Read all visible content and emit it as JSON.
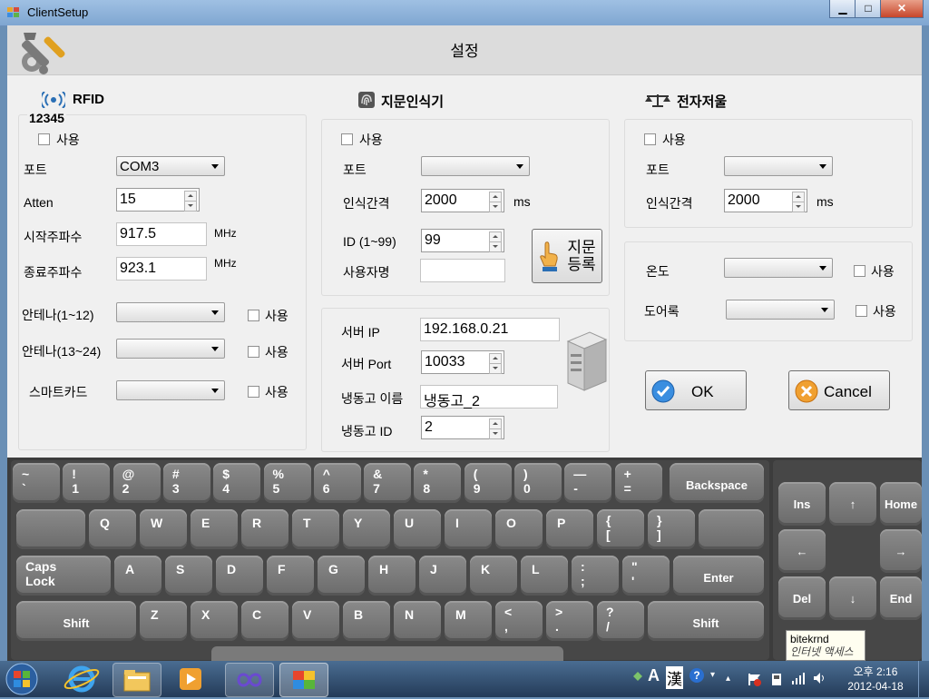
{
  "window": {
    "title": "ClientSetup",
    "min": "▁",
    "max": "□",
    "close": "✕"
  },
  "header": {
    "title": "설정"
  },
  "rfid": {
    "title": "RFID",
    "code": "12345",
    "use_label": "사용",
    "port_label": "포트",
    "port_value": "COM3",
    "atten_label": "Atten",
    "atten_value": "15",
    "start_freq_label": "시작주파수",
    "start_freq_value": "917.5",
    "end_freq_label": "종료주파수",
    "end_freq_value": "923.1",
    "mhz": "MHz",
    "antenna1_label": "안테나(1~12)",
    "antenna2_label": "안테나(13~24)",
    "smartcard_label": "스마트카드",
    "antenna1_use": "사용",
    "antenna2_use": "사용",
    "smartcard_use": "사용"
  },
  "finger": {
    "title": "지문인식기",
    "use_label": "사용",
    "port_label": "포트",
    "interval_label": "인식간격",
    "interval_value": "2000",
    "ms": "ms",
    "id_label": "ID (1~99)",
    "id_value": "99",
    "user_label": "사용자명",
    "user_value": "",
    "register_line1": "지문",
    "register_line2": "등록"
  },
  "server": {
    "ip_label": "서버 IP",
    "ip_value": "192.168.0.21",
    "port_label": "서버 Port",
    "port_value": "10033",
    "fridge_name_label": "냉동고 이름",
    "fridge_name_value": "냉동고_2",
    "fridge_id_label": "냉동고 ID",
    "fridge_id_value": "2"
  },
  "scale": {
    "title": "전자저울",
    "use_label": "사용",
    "port_label": "포트",
    "interval_label": "인식간격",
    "interval_value": "2000",
    "ms": "ms"
  },
  "sensors": {
    "temp_label": "온도",
    "temp_use": "사용",
    "door_label": "도어록",
    "door_use": "사용"
  },
  "buttons": {
    "ok": "OK",
    "cancel": "Cancel"
  },
  "keyboard": {
    "row1": [
      [
        "~",
        "`"
      ],
      [
        "!",
        "1"
      ],
      [
        "@",
        "2"
      ],
      [
        "#",
        "3"
      ],
      [
        "$",
        "4"
      ],
      [
        "%",
        "5"
      ],
      [
        "^",
        "6"
      ],
      [
        "&",
        "7"
      ],
      [
        "*",
        "8"
      ],
      [
        "(",
        "9"
      ],
      [
        ")",
        "0"
      ],
      [
        "—",
        "-"
      ],
      [
        "+",
        "="
      ]
    ],
    "backspace": "Backspace",
    "row2": [
      "Q",
      "W",
      "E",
      "R",
      "T",
      "Y",
      "U",
      "I",
      "O",
      "P"
    ],
    "row2_brackets": [
      [
        "{",
        "["
      ],
      [
        "}",
        "]"
      ]
    ],
    "row3": [
      "A",
      "S",
      "D",
      "F",
      "G",
      "H",
      "J",
      "K",
      "L"
    ],
    "row3_punct": [
      [
        ":",
        ";"
      ],
      [
        "\"",
        "'"
      ]
    ],
    "caps_line1": "Caps",
    "caps_line2": "Lock",
    "enter": "Enter",
    "row4": [
      "Z",
      "X",
      "C",
      "V",
      "B",
      "N",
      "M"
    ],
    "row4_punct": [
      [
        "<",
        ","
      ],
      [
        ">",
        "."
      ],
      [
        "?",
        "/"
      ]
    ],
    "shift": "Shift",
    "ins": "Ins",
    "home": "Home",
    "del": "Del",
    "end": "End",
    "up": "↑",
    "down": "↓",
    "left": "←",
    "right": "→"
  },
  "tooltip": {
    "line1": "bitekrnd",
    "line2": "인터넷 액세스"
  },
  "taskbar": {
    "ampm_time": "오후 2:16",
    "date": "2012-04-18",
    "ime_a": "A",
    "ime_han": "漢"
  }
}
